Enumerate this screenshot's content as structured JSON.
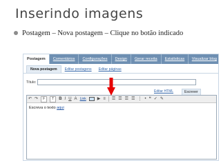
{
  "slide": {
    "title": "Inserindo imagens",
    "bullet": "Postagem – Nova postagem – Clique no botão indicado"
  },
  "colors": {
    "title_text": "#444444",
    "tab_bar": "#6e8fb2",
    "arrow": "#e60000",
    "link": "#1a4fa0"
  },
  "screenshot": {
    "tabs": [
      {
        "label": "Postagem",
        "active": true
      },
      {
        "label": "Comentários",
        "active": false
      },
      {
        "label": "Configurações",
        "active": false
      },
      {
        "label": "Design",
        "active": false
      },
      {
        "label": "Gerar receita",
        "active": false
      },
      {
        "label": "Estatísticas",
        "active": false
      }
    ],
    "view_blog": "Visualizar blog",
    "subtabs": [
      {
        "label": "Nova postagem",
        "active": true
      },
      {
        "label": "Editar postagens",
        "active": false
      },
      {
        "label": "Editar páginas",
        "active": false
      }
    ],
    "title_label": "Título:",
    "modes": {
      "html": "Editar HTML",
      "write": "Escrever"
    },
    "toolbar": {
      "font": "F",
      "size": "T",
      "bold": "B",
      "italic": "I",
      "underline": "U",
      "color": "A",
      "link": "Link",
      "icons": [
        "undo-icon",
        "redo-icon",
        "font-select",
        "size-select",
        "bold-icon",
        "italic-icon",
        "underline-icon",
        "text-color-icon",
        "link-icon",
        "image-icon",
        "video-icon",
        "jump-break-icon",
        "align-left-icon",
        "align-center-icon",
        "align-right-icon",
        "justify-icon",
        "numbered-list-icon",
        "bullet-list-icon",
        "quote-icon",
        "spellcheck-icon",
        "clear-format-icon"
      ]
    },
    "editor": {
      "body_prefix": "Escreva o texto",
      "body_link": "aqui"
    },
    "pointer": "arrow-down-icon"
  }
}
